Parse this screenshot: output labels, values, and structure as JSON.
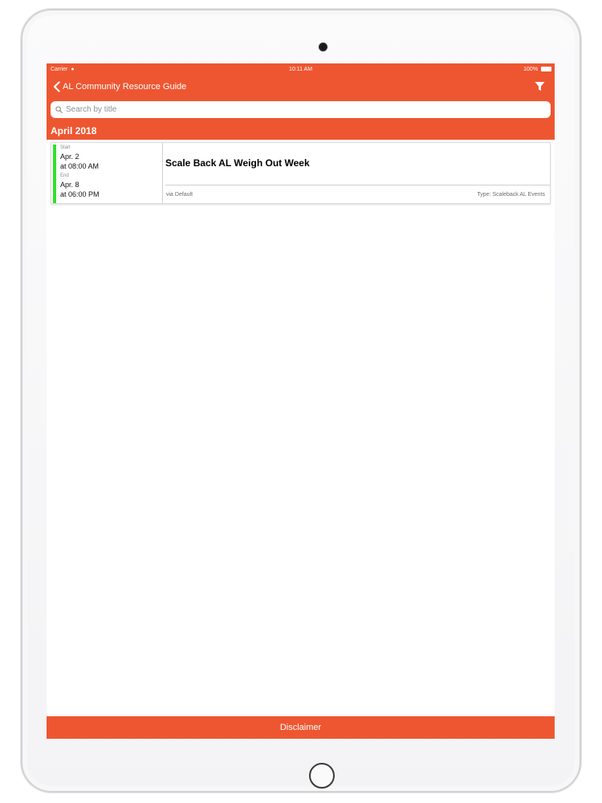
{
  "status_bar": {
    "carrier": "Carrier",
    "time": "10:11 AM",
    "battery": "100%"
  },
  "nav": {
    "back_label": "AL Community Resource Guide",
    "filter_icon": "filter-icon"
  },
  "search": {
    "placeholder": "Search by title"
  },
  "section": {
    "title": "April 2018"
  },
  "event": {
    "start_label": "Start",
    "start_date": "Apr. 2",
    "start_time": "at 08:00 AM",
    "end_label": "End",
    "end_date": "Apr. 8",
    "end_time": "at 06:00 PM",
    "title": "Scale Back AL Weigh Out Week",
    "source": "via Default",
    "type": "Type: Scaleback AL Events",
    "status_color": "#2ee32c"
  },
  "footer": {
    "disclaimer_label": "Disclaimer"
  },
  "colors": {
    "accent": "#ee5631"
  }
}
